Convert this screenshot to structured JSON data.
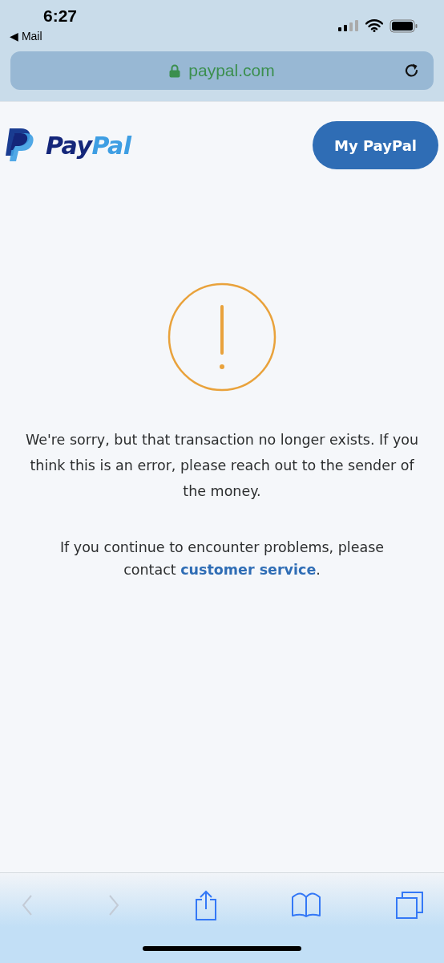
{
  "status_bar": {
    "time": "6:27",
    "back_app": "◀ Mail"
  },
  "address_bar": {
    "url": "paypal.com",
    "secure": true
  },
  "header": {
    "logo_parts": [
      "Pay",
      "Pal"
    ],
    "button": "My PayPal"
  },
  "message": {
    "paragraph": "We're sorry, but that transaction no longer exists. If you think this is an error, please reach out to the sender of the money.",
    "help_before": "If you continue to encounter problems, please contact ",
    "help_link": "customer service",
    "help_after": "."
  },
  "toolbar": [
    {
      "kind": "back",
      "disabled": true
    },
    {
      "kind": "forward",
      "disabled": true
    },
    {
      "kind": "share",
      "disabled": false
    },
    {
      "kind": "bookmarks",
      "disabled": false
    },
    {
      "kind": "tabs",
      "disabled": false
    }
  ]
}
